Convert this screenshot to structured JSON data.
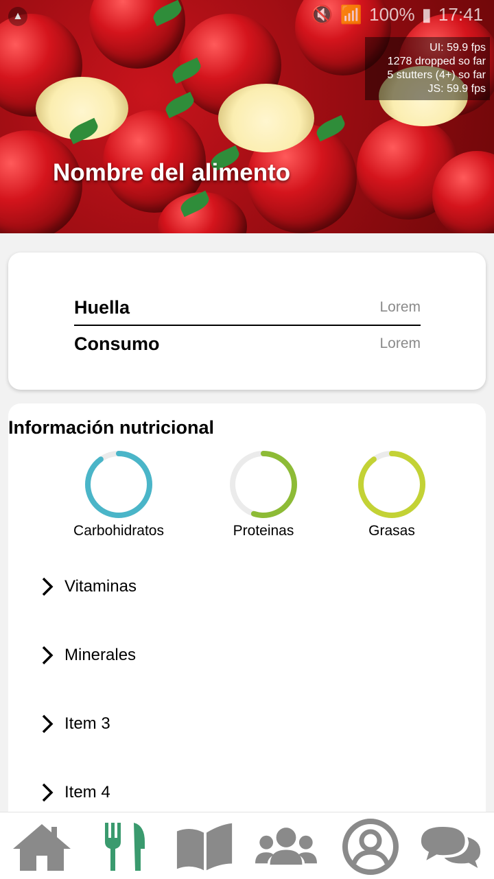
{
  "hero": {
    "title": "Nombre del alimento"
  },
  "status_bar": {
    "battery": "100%",
    "time": "17:41"
  },
  "perf_monitor": {
    "ui_fps": "UI: 59.9 fps",
    "dropped": "1278 dropped so far",
    "stutters": "5 stutters (4+) so far",
    "js_fps": "JS: 59.9 fps"
  },
  "summary": {
    "rows": [
      {
        "label": "Huella",
        "value": "Lorem"
      },
      {
        "label": "Consumo",
        "value": "Lorem"
      }
    ]
  },
  "nutrition": {
    "title": "Información nutricional",
    "rings": [
      {
        "label": "Carbohidratos",
        "percent": 90,
        "color": "#4ab5c8"
      },
      {
        "label": "Proteinas",
        "percent": 55,
        "color": "#8dbb36"
      },
      {
        "label": "Grasas",
        "percent": 90,
        "color": "#c3d235"
      }
    ],
    "sections": [
      {
        "label": "Vitaminas"
      },
      {
        "label": "Minerales"
      },
      {
        "label": "Item 3"
      },
      {
        "label": "Item 4"
      }
    ]
  },
  "nav": {
    "items": [
      {
        "icon": "home-icon",
        "active": false
      },
      {
        "icon": "fork-knife-icon",
        "active": true
      },
      {
        "icon": "book-icon",
        "active": false
      },
      {
        "icon": "users-icon",
        "active": false
      },
      {
        "icon": "profile-icon",
        "active": false
      },
      {
        "icon": "chat-icon",
        "active": false
      }
    ],
    "active_color": "#3a9a6e",
    "inactive_color": "#8a8a8a"
  }
}
